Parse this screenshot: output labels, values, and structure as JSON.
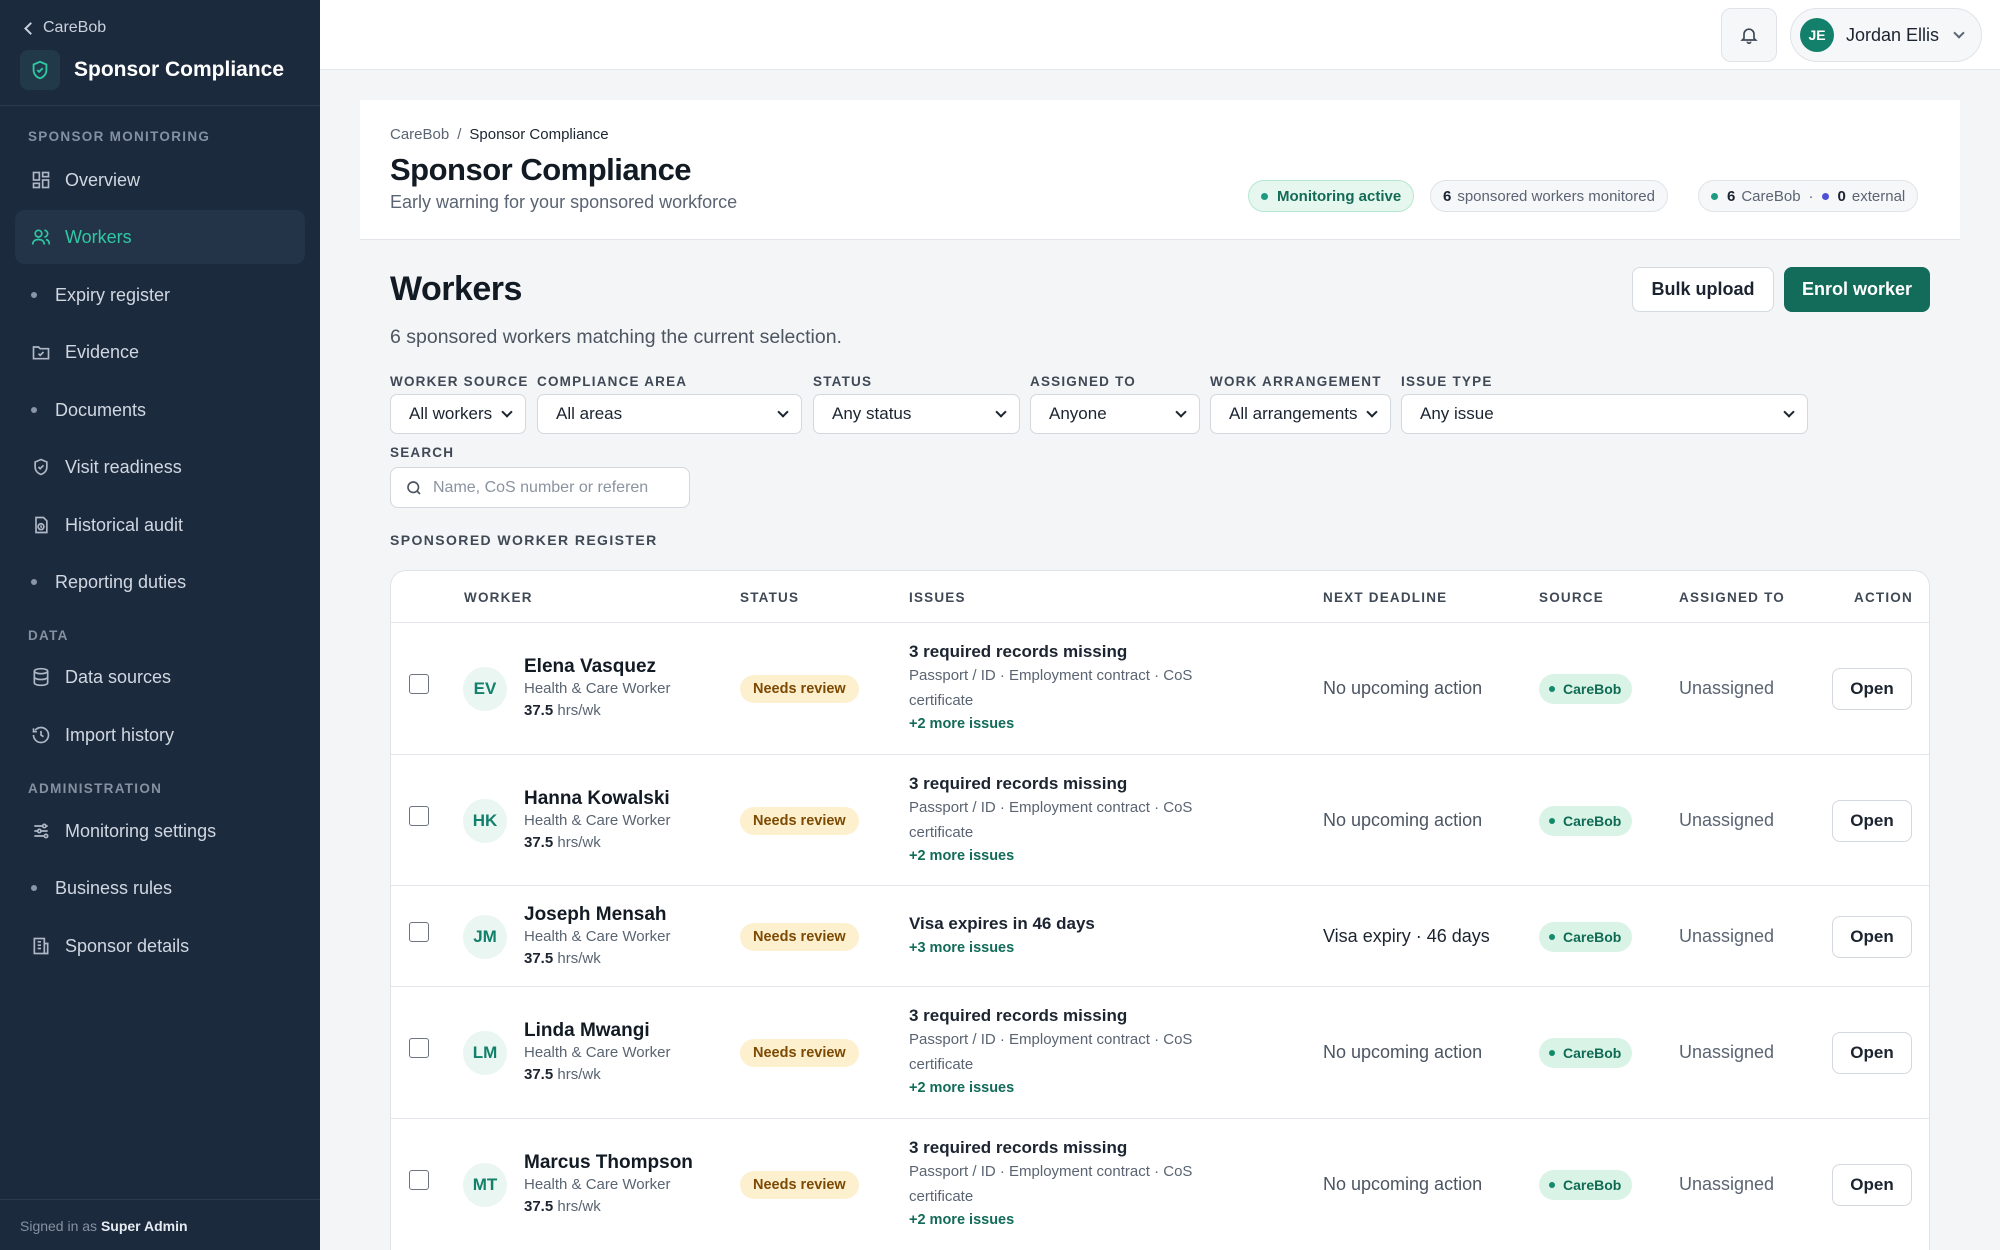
{
  "sidebar": {
    "back_label": "CareBob",
    "brand_title": "Sponsor Compliance",
    "sections": {
      "monitoring": "SPONSOR MONITORING",
      "data": "DATA",
      "admin": "ADMINISTRATION"
    },
    "items": [
      {
        "label": "Overview",
        "icon": "grid-icon"
      },
      {
        "label": "Workers",
        "icon": "users-icon",
        "active": true
      },
      {
        "label": "Expiry register",
        "icon": "dot"
      },
      {
        "label": "Evidence",
        "icon": "folder-check-icon"
      },
      {
        "label": "Documents",
        "icon": "dot"
      },
      {
        "label": "Visit readiness",
        "icon": "shield-check-icon"
      },
      {
        "label": "Historical audit",
        "icon": "file-clock-icon"
      },
      {
        "label": "Reporting duties",
        "icon": "dot"
      },
      {
        "label": "Data sources",
        "icon": "database-icon"
      },
      {
        "label": "Import history",
        "icon": "history-icon"
      },
      {
        "label": "Monitoring settings",
        "icon": "sliders-icon"
      },
      {
        "label": "Business rules",
        "icon": "dot"
      },
      {
        "label": "Sponsor details",
        "icon": "building-icon"
      }
    ],
    "footer_prefix": "Signed in as",
    "footer_user": "Super Admin"
  },
  "topbar": {
    "user_initials": "JE",
    "user_name": "Jordan Ellis"
  },
  "header": {
    "breadcrumb_root": "CareBob",
    "breadcrumb_sep": "/",
    "breadcrumb_current": "Sponsor Compliance",
    "title": "Sponsor Compliance",
    "subtitle": "Early warning for your sponsored workforce",
    "pill_monitoring": "Monitoring active",
    "pill_workers_count": "6",
    "pill_workers_text": "sponsored workers monitored",
    "pill_carebob_count": "6",
    "pill_carebob_text": "CareBob",
    "pill_sep": "·",
    "pill_external_count": "0",
    "pill_external_text": "external"
  },
  "workers": {
    "title": "Workers",
    "subtitle": "6 sponsored workers matching the current selection.",
    "bulk_upload": "Bulk upload",
    "enrol_worker": "Enrol worker"
  },
  "filters": {
    "worker_source": {
      "label": "WORKER SOURCE",
      "value": "All workers"
    },
    "compliance_area": {
      "label": "COMPLIANCE AREA",
      "value": "All areas"
    },
    "status": {
      "label": "STATUS",
      "value": "Any status"
    },
    "assigned_to": {
      "label": "ASSIGNED TO",
      "value": "Anyone"
    },
    "work_arrangement": {
      "label": "WORK ARRANGEMENT",
      "value": "All arrangements"
    },
    "issue_type": {
      "label": "ISSUE TYPE",
      "value": "Any issue"
    },
    "search": {
      "label": "SEARCH",
      "placeholder": "Name, CoS number or referen"
    }
  },
  "register": {
    "label": "SPONSORED WORKER REGISTER",
    "columns": [
      "WORKER",
      "STATUS",
      "ISSUES",
      "NEXT DEADLINE",
      "SOURCE",
      "ASSIGNED TO",
      "ACTION"
    ],
    "rows": [
      {
        "initials": "EV",
        "name": "Elena Vasquez",
        "role": "Health & Care Worker",
        "hours": "37.5",
        "hours_unit": "hrs/wk",
        "status": "Needs review",
        "issue_title": "3 required records missing",
        "issue_desc": "Passport / ID · Employment contract · CoS certificate",
        "issue_more": "+2 more issues",
        "deadline": "No upcoming action",
        "source": "CareBob",
        "assigned": "Unassigned",
        "action": "Open"
      },
      {
        "initials": "HK",
        "name": "Hanna Kowalski",
        "role": "Health & Care Worker",
        "hours": "37.5",
        "hours_unit": "hrs/wk",
        "status": "Needs review",
        "issue_title": "3 required records missing",
        "issue_desc": "Passport / ID · Employment contract · CoS certificate",
        "issue_more": "+2 more issues",
        "deadline": "No upcoming action",
        "source": "CareBob",
        "assigned": "Unassigned",
        "action": "Open"
      },
      {
        "initials": "JM",
        "name": "Joseph Mensah",
        "role": "Health & Care Worker",
        "hours": "37.5",
        "hours_unit": "hrs/wk",
        "status": "Needs review",
        "issue_title": "Visa expires in 46 days",
        "issue_desc": "",
        "issue_more": "+3 more issues",
        "deadline": "Visa expiry · 46 days",
        "source": "CareBob",
        "assigned": "Unassigned",
        "action": "Open"
      },
      {
        "initials": "LM",
        "name": "Linda Mwangi",
        "role": "Health & Care Worker",
        "hours": "37.5",
        "hours_unit": "hrs/wk",
        "status": "Needs review",
        "issue_title": "3 required records missing",
        "issue_desc": "Passport / ID · Employment contract · CoS certificate",
        "issue_more": "+2 more issues",
        "deadline": "No upcoming action",
        "source": "CareBob",
        "assigned": "Unassigned",
        "action": "Open"
      },
      {
        "initials": "MT",
        "name": "Marcus Thompson",
        "role": "Health & Care Worker",
        "hours": "37.5",
        "hours_unit": "hrs/wk",
        "status": "Needs review",
        "issue_title": "3 required records missing",
        "issue_desc": "Passport / ID · Employment contract · CoS certificate",
        "issue_more": "+2 more issues",
        "deadline": "No upcoming action",
        "source": "CareBob",
        "assigned": "Unassigned",
        "action": "Open"
      }
    ]
  }
}
